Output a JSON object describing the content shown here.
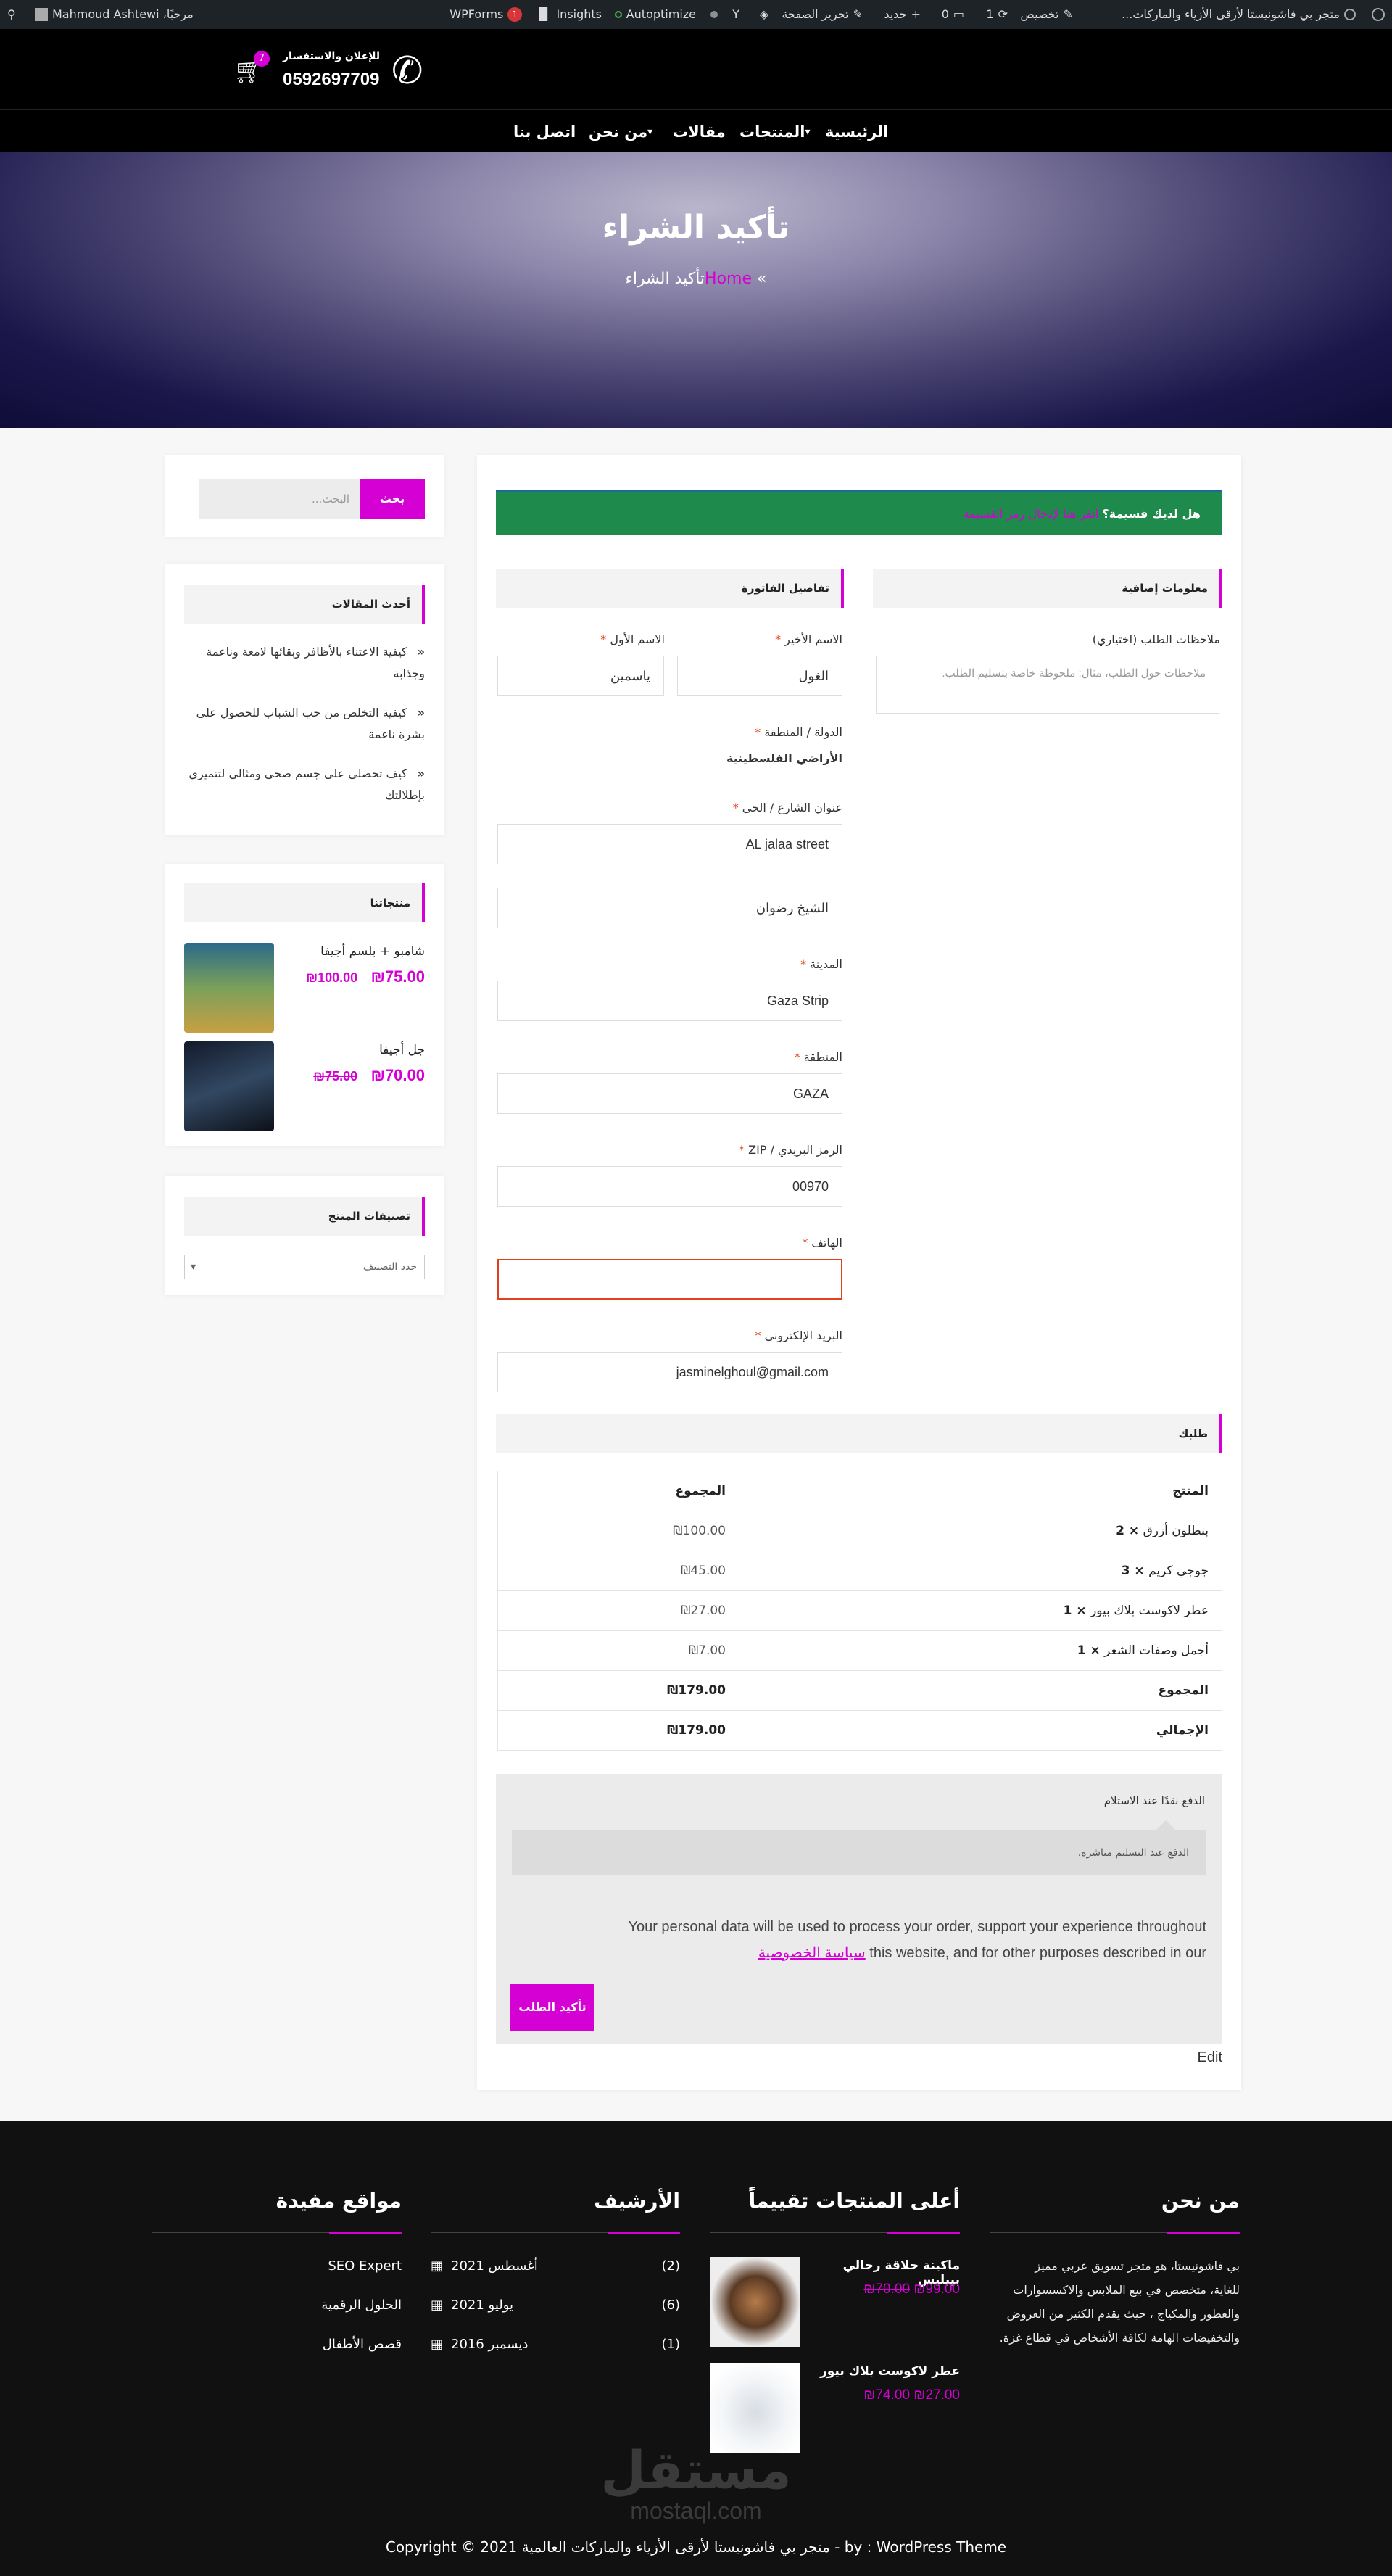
{
  "admin_bar": {
    "site_title": "متجر بي فاشونيستا لأرقى الأزياء والماركات...",
    "customize": "تخصيص",
    "updates_count": "1",
    "comments_count": "0",
    "new_label": "جديد",
    "edit_page": "تحرير الصفحة",
    "autoptimize": "Autoptimize",
    "insights": "Insights",
    "wpforms": "WPForms",
    "wpforms_badge": "1",
    "user_greeting": "مرحبًا، Mahmoud Ashtewi"
  },
  "header": {
    "contact_label": "للإعلان والاستفسار",
    "phone": "0592697709",
    "cart_count": "7"
  },
  "nav": {
    "items": [
      "الرئيسية",
      "المنتجات",
      "مقالات",
      "من نحن",
      "اتصل بنا"
    ]
  },
  "hero": {
    "title": "تأكيد الشراء",
    "breadcrumb_home": "Home",
    "breadcrumb_sep": "»",
    "breadcrumb_current": "تأكيد الشراء"
  },
  "coupon": {
    "question": "هل لديك قسيمة؟",
    "link": "انقر هنا لإدخال رمز القسيمة"
  },
  "billing": {
    "heading": "تفاصيل الفاتورة",
    "last_name_label": "الاسم الأخير",
    "last_name_value": "الغول",
    "first_name_label": "الاسم الأول",
    "first_name_value": "ياسمين",
    "country_label": "الدولة / المنطقة",
    "country_value": "الأراضي الفلسطينية",
    "street_label": "عنوان الشارع / الحي",
    "street_value": "AL jalaa street",
    "street2_value": "الشيخ رضوان",
    "city_label": "المدينة",
    "city_value": "Gaza Strip",
    "region_label": "المنطقة",
    "region_value": "GAZA",
    "zip_label": "الرمز البريدي / ZIP",
    "zip_value": "00970",
    "phone_label": "الهاتف",
    "phone_value": "",
    "email_label": "البريد الإلكتروني",
    "email_value": "jasminelghoul@gmail.com",
    "required_mark": "*"
  },
  "additional": {
    "heading": "معلومات إضافية",
    "notes_label": "ملاحظات الطلب (اختياري)",
    "notes_placeholder": "ملاحظات حول الطلب، مثال: ملحوظة خاصة بتسليم الطلب."
  },
  "order": {
    "heading": "طلبك",
    "col_product": "المنتج",
    "col_total": "المجموع",
    "rows": [
      {
        "name": "بنطلون أزرق",
        "qty": "× 2",
        "total": "₪100.00"
      },
      {
        "name": "جوجي كريم",
        "qty": "× 3",
        "total": "₪45.00"
      },
      {
        "name": "عطر لاكوست بلاك بيور",
        "qty": "× 1",
        "total": "₪27.00"
      },
      {
        "name": "أجمل وصفات الشعر",
        "qty": "× 1",
        "total": "₪7.00"
      }
    ],
    "subtotal_label": "المجموع",
    "subtotal_value": "₪179.00",
    "grand_label": "الإجمالي",
    "grand_value": "₪179.00"
  },
  "payment": {
    "method": "الدفع نقدًا عند الاستلام",
    "description": "الدفع عند التسليم مباشرة.",
    "privacy_text_1": "Your personal data will be used to process your order, support your experience throughout",
    "privacy_text_2": "this website, and for other purposes described in our",
    "privacy_link": "سياسة الخصوصية",
    "place_order": "تأكيد الطلب",
    "edit": "Edit"
  },
  "sidebar": {
    "search_placeholder": "البحث...",
    "search_button": "بحث",
    "recent_heading": "أحدث المقالات",
    "recent_posts": [
      [
        "كيفية الاعتناء بالأظافر وبقائها لامعة وناعمة",
        "وجذابة"
      ],
      [
        "كيفية التخلص من حب الشباب للحصول على",
        "بشرة ناعمة"
      ],
      [
        "كيف تحصلي على جسم صحي ومثالي لتتميزي",
        "بإطلالتك"
      ]
    ],
    "products_heading": "منتجاتنا",
    "products": [
      {
        "name": "شامبو + بلسم أجيفا",
        "old": "₪100.00",
        "new": "₪75.00"
      },
      {
        "name": "جل أجيفا",
        "old": "₪75.00",
        "new": "₪70.00"
      }
    ],
    "categories_heading": "تصنيفات المنتج",
    "categories_placeholder": "حدد التصنيف"
  },
  "footer": {
    "about_heading": "من نحن",
    "about_text": [
      "بي فاشونيستا، هو متجر تسويق عربي مميز",
      "للغاية، متخصص في بيع الملابس والاكسسوارات",
      "والعطور والمكياج ، حيث يقدم الكثير من العروض",
      "والتخفيضات الهامة لكافة الأشخاص في قطاع غزة."
    ],
    "top_heading": "أعلى المنتجات تقييماً",
    "top_products": [
      {
        "name": "ماكينة حلاقة رجالي بيبليس",
        "old": "₪70.00",
        "new": "₪99.00"
      },
      {
        "name": "عطر لاكوست بلاك بيور",
        "old": "₪74.00",
        "new": "₪27.00"
      }
    ],
    "archive_heading": "الأرشيف",
    "archive": [
      {
        "label": "أغسطس 2021",
        "count": "(2)"
      },
      {
        "label": "يوليو 2021",
        "count": "(6)"
      },
      {
        "label": "ديسمبر 2016",
        "count": "(1)"
      }
    ],
    "links_heading": "مواقع مفيدة",
    "links": [
      "SEO Expert",
      "الحلول الرقمية",
      "قصص الأطفال"
    ],
    "watermark_ar": "مستقل",
    "watermark_en": "mostaql.com",
    "copyright": "Copyright © 2021 متجر بي فاشونيستا لأرقى الأزياء والماركات العالمية - by : WordPress Theme"
  }
}
